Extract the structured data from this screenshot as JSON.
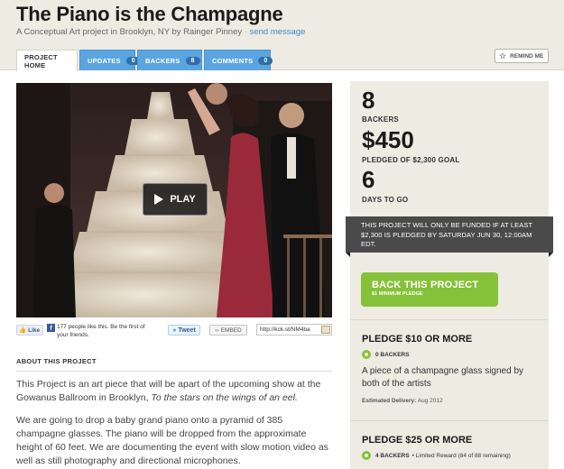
{
  "project": {
    "title": "The Piano is the Champagne",
    "subtitle": "A Conceptual Art project in Brooklyn, NY by Rainger Pinney",
    "separator": "·",
    "send_message": "send message"
  },
  "tabs": [
    {
      "label": "PROJECT HOME"
    },
    {
      "label": "UPDATES",
      "count": "0"
    },
    {
      "label": "BACKERS",
      "count": "8"
    },
    {
      "label": "COMMENTS",
      "count": "0"
    }
  ],
  "remind_me": "REMIND ME",
  "video": {
    "play_label": "PLAY"
  },
  "social": {
    "like_label": "Like",
    "fb_text": "177 people like this. Be the first of your friends.",
    "tweet_label": "Tweet",
    "embed_label": "EMBED",
    "short_url": "http://kck.st/NM4ba"
  },
  "about": {
    "heading": "ABOUT THIS PROJECT",
    "p1_text": "This Project is an art piece that will be apart of the upcoming show at the Gowanus Ballroom in Brooklyn, ",
    "p1_italic": "To the stars on the wings of an eel.",
    "p2": "We are going to drop a baby grand piano onto a pyramid of 385 champagne glasses. The piano will be dropped from the approximate height of 60 feet. We are documenting the event with slow motion video as well as still photography and directional microphones."
  },
  "stats": {
    "backers_value": "8",
    "backers_label": "BACKERS",
    "pledged_value": "$450",
    "pledged_label": "PLEDGED OF $2,300 GOAL",
    "days_value": "6",
    "days_label": "DAYS TO GO"
  },
  "notice": "THIS PROJECT WILL ONLY BE FUNDED IF AT LEAST $2,300 IS PLEDGED BY SATURDAY JUN 30, 12:00AM EDT.",
  "back_button": {
    "label": "BACK THIS PROJECT",
    "sub": "$1 MINIMUM PLEDGE"
  },
  "pledges": [
    {
      "heading": "PLEDGE $10 OR MORE",
      "backers": "0 BACKERS",
      "limited": "",
      "description": "A piece of a champagne glass signed by both of the artists",
      "delivery_label": "Estimated Delivery:",
      "delivery_date": "Aug 2012"
    },
    {
      "heading": "PLEDGE $25 OR MORE",
      "backers": "4 BACKERS",
      "limited": "• Limited Reward (84 of 88 remaining)"
    }
  ],
  "colors": {
    "accent_blue": "#5aa5e0",
    "back_green": "#86c13a",
    "panel_bg": "#eeebe3",
    "link": "#3d8cc9"
  }
}
